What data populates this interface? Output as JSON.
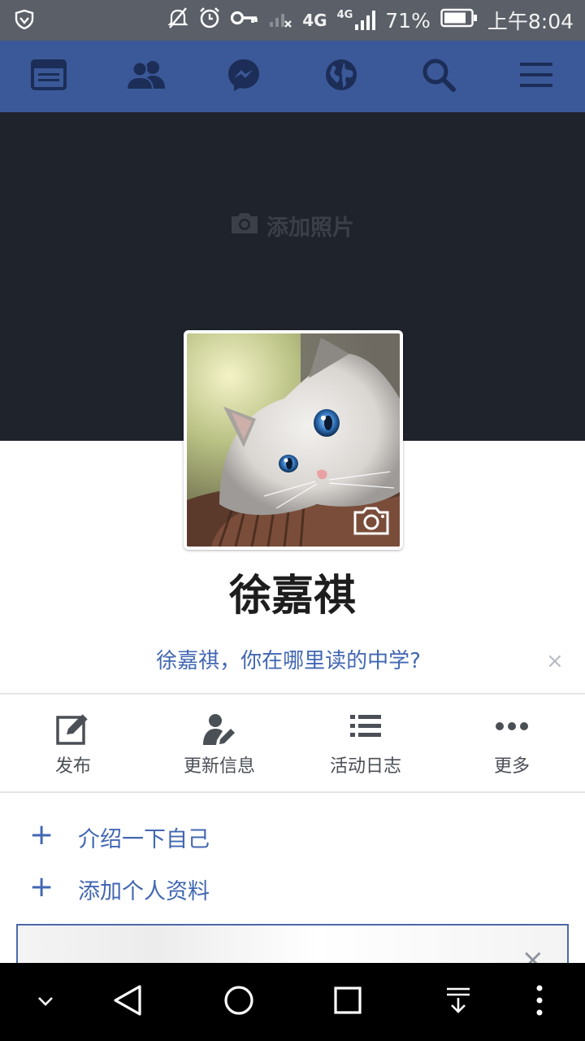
{
  "status_bar": {
    "network_label": "4G",
    "network_label_small": "4G",
    "battery_percent": "71%",
    "time": "上午8:04"
  },
  "cover": {
    "add_photo_label": "添加照片"
  },
  "profile": {
    "name": "徐嘉祺",
    "prompt_text": "徐嘉祺，你在哪里读的中学?",
    "prompt_close": "×"
  },
  "actions": [
    {
      "label": "发布",
      "icon": "edit-icon"
    },
    {
      "label": "更新信息",
      "icon": "person-edit-icon"
    },
    {
      "label": "活动日志",
      "icon": "list-icon"
    },
    {
      "label": "更多",
      "icon": "more-dots-icon"
    }
  ],
  "add_items": [
    {
      "plus": "+",
      "label": "介绍一下自己"
    },
    {
      "plus": "+",
      "label": "添加个人资料"
    }
  ],
  "card": {
    "close": "×"
  },
  "colors": {
    "nav_blue": "#3b5998",
    "link_blue": "#4267b2",
    "cover_dark": "#1f232c",
    "icon_dark": "#1c2d57"
  }
}
